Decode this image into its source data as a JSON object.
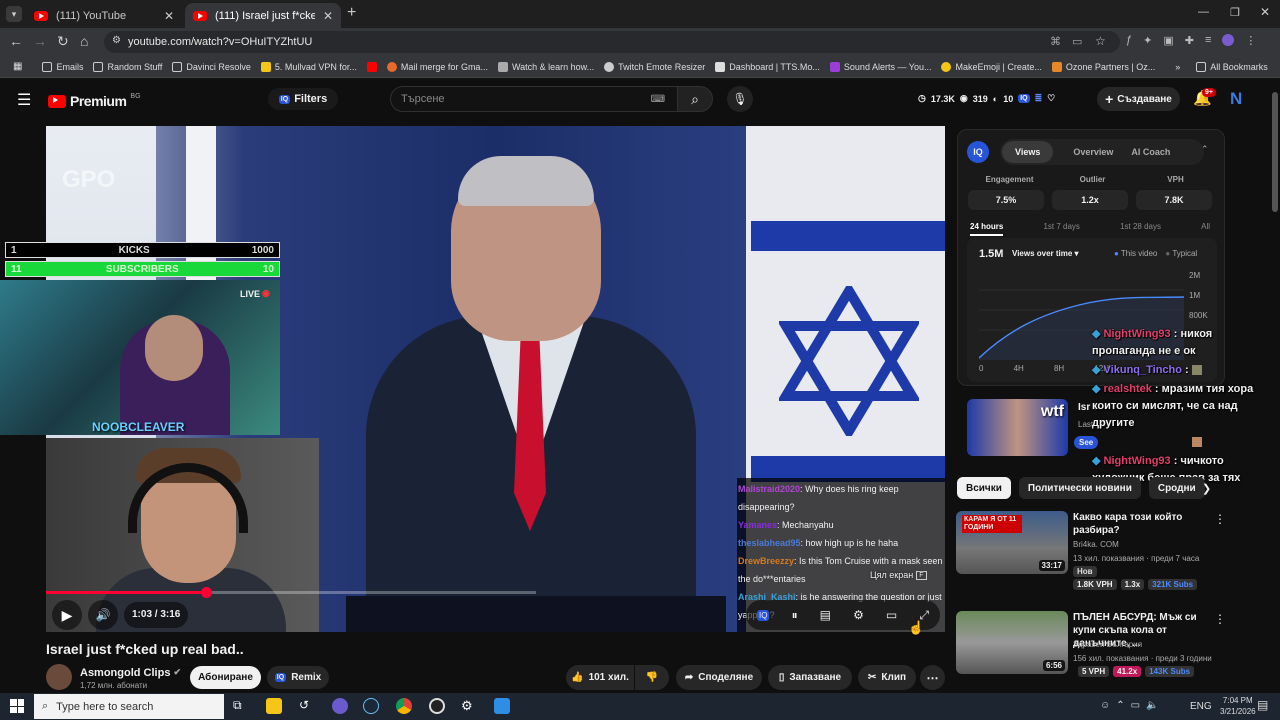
{
  "browser": {
    "tabs": [
      {
        "title": "(111) YouTube"
      },
      {
        "title": "(111) Israel just f*cked up real b"
      }
    ],
    "new_tab": "+",
    "url": "youtube.com/watch?v=OHuITYZhtUU",
    "bookmarks": [
      "Emails",
      "Random Stuff",
      "Davinci Resolve",
      "5. Mullvad VPN for...",
      "",
      "Mail merge for Gma...",
      "Watch & learn how...",
      "Twitch Emote Resizer",
      "Dashboard | TTS.Mo...",
      "Sound Alerts — You...",
      "MakeEmoji | Create...",
      "Ozone Partners | Oz..."
    ],
    "all_bookmarks": "All Bookmarks"
  },
  "youtube": {
    "logo_text": "Premium",
    "country": "BG",
    "filters_label": "Filters",
    "search_placeholder": "Търсене",
    "header_stats": {
      "views": "17.3K",
      "eye": "319",
      "count": "10"
    },
    "create_label": "Създаване",
    "notif_badge": "9+"
  },
  "overlay": {
    "kicks_left": "1",
    "kicks_label": "KICKS",
    "kicks_right": "1000",
    "subs_left": "11",
    "subs_label": "SUBSCRIBERS",
    "subs_right": "10",
    "live": "LIVE",
    "streamer_tag": "NOOBCLEAVER",
    "watermark": "GPO"
  },
  "caption_chat": [
    {
      "user": "Malistraid2020",
      "color": "#b044d6",
      "msg": "Why does his ring keep disappearing?"
    },
    {
      "user": "Yamanes",
      "color": "#8a2be2",
      "msg": "Mechanyahu"
    },
    {
      "user": "theslabhead95",
      "color": "#4a7bd8",
      "msg": "how high up is he haha"
    },
    {
      "user": "DrewBreezzy",
      "color": "#d87a1f",
      "msg": "Is this Tom Cruise with a mask seen the do***entaries"
    },
    {
      "user": "Arashi_Kashi",
      "color": "#3aa0d8",
      "msg": "is he answering the question or just yapping?"
    }
  ],
  "fullscreen_tip": {
    "label": "Цял екран",
    "key": "F"
  },
  "player": {
    "time": "1:03 / 3:16",
    "progress": 0.327,
    "accent": "#ff0033"
  },
  "video": {
    "title": "Israel just f*cked up real bad..",
    "channel": "Asmongold Clips",
    "subscribers": "1,72 млн. абонати",
    "subscribe_label": "Абониране",
    "remix_label": "Remix",
    "likes": "101 хил.",
    "share_label": "Споделяне",
    "save_label": "Запазване",
    "clip_label": "Клип"
  },
  "iq_panel": {
    "tabs": [
      "Views",
      "Overview",
      "AI Coach"
    ],
    "stat_labels": [
      "Engagement",
      "Outlier",
      "VPH"
    ],
    "stat_values": [
      "7.5%",
      "1.2x",
      "7.8K"
    ],
    "ranges": [
      "24 hours",
      "1st 7 days",
      "1st 28 days",
      "All"
    ],
    "total": "1.5M",
    "mode": "Views over time",
    "legend_this": "This video",
    "legend_typical": "Typical",
    "y_ticks": [
      "2M",
      "1M",
      "800K"
    ],
    "x_ticks": [
      "0",
      "4H",
      "8H",
      "12H"
    ]
  },
  "twitch_chat": [
    {
      "user": "NightWing93",
      "color": "#e0406a",
      "msg": "никоя пропаганда не е ок"
    },
    {
      "user": "Vikunq_Tincho",
      "color": "#8f6ef0",
      "msg": ""
    },
    {
      "user": "realshtek",
      "color": "#e0406a",
      "msg": "мразим тия хора които си мислят, че са над другите"
    },
    {
      "user": "",
      "color": "#ffffff",
      "msg": ""
    },
    {
      "user": "NightWing93",
      "color": "#e0406a",
      "msg": "чичкото художник беше прав за тях"
    }
  ],
  "related_partial": {
    "title": "Isr",
    "sub": "Last",
    "see_label": "See"
  },
  "chips": [
    "Всички",
    "Политически новини",
    "Сродни"
  ],
  "recommendations": [
    {
      "title": "Какво кара този който разбира?",
      "channel": "Bri4ka. COM",
      "meta": "13 хил. показвания · преди 7 часа",
      "badge": "Нов",
      "tags": [
        "1.8K VPH",
        "1.3x",
        "321K Subs"
      ],
      "duration": "33:17",
      "thumb_text": "КАРАМ Я ОТ 11 ГОДИНИ"
    },
    {
      "title": "ПЪЛЕН АБСУРД: Мъж си купи скъпа кола от данъчните, ...",
      "channel": "Здравей България",
      "meta": "156 хил. показвания · преди 3 години",
      "badge": "",
      "tags": [
        "5 VPH",
        "41.2x",
        "143K Subs"
      ],
      "duration": "6:56",
      "thumb_text": ""
    }
  ],
  "taskbar": {
    "search": "Type here to search",
    "lang": "ENG",
    "time": "7:04 PM",
    "date": "3/21/2026"
  }
}
